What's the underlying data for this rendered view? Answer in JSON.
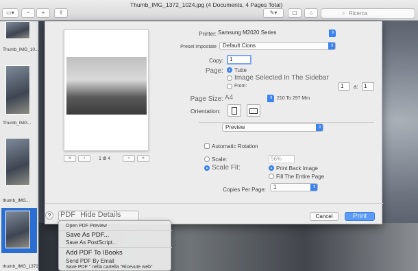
{
  "window": {
    "title": "Thumb_IMG_1372_1024.jpg (4 Documents, 4 Pages Total)",
    "search_placeholder": "Ricerca"
  },
  "sidebar": {
    "items": [
      {
        "label": "Thumb_IMG_10..."
      },
      {
        "label": "Thumb_IMG..."
      },
      {
        "label": "thumb_IMG..."
      },
      {
        "label": "thumb_IMG_1372_1024"
      }
    ]
  },
  "print": {
    "printer_label": "Printer:",
    "printer_value": "Samsung M2020 Series",
    "preset_label": "Preset Impostate",
    "preset_value": "Default Cions",
    "copy_label": "Copy:",
    "copy_value": "1",
    "page_label": "Page:",
    "page_all": "Tutte",
    "page_selected": "Image Selected In The Sidebar",
    "page_from": "From:",
    "page_from_value": "1",
    "page_to": "a:",
    "page_to_value": "1",
    "page_size_label": "Page Size:",
    "page_size_value": "A4",
    "page_size_dims": "210 To 297 Mm",
    "orientation_label": "Orientation:",
    "section_value": "Preview",
    "auto_rotation": "Automatic Rotation",
    "scale_label": "Scale:",
    "scale_value": "56%",
    "scale_fit_label": "Scale Fit:",
    "print_back_image": "Print Back Image",
    "fill_entire_page": "Fill The Entire Page",
    "copies_per_page_label": "Copies Per Page:",
    "copies_per_page_value": "1",
    "pager_text": "1 di 4",
    "help": "?",
    "pdf_button": "PDF",
    "hide_details": "Hide Details",
    "cancel": "Cancel",
    "print": "Print"
  },
  "pdf_menu": {
    "items": [
      "Open PDF Preview",
      "Save As PDF...",
      "Save As PostScript...",
      "Add PDF To IBooks",
      "Send PDF By Email",
      "Save PDF \" nella cartella \"Ricevute web\""
    ]
  },
  "colors": {
    "accent": "#3a83f0",
    "sheet_bg": "#ececec"
  }
}
